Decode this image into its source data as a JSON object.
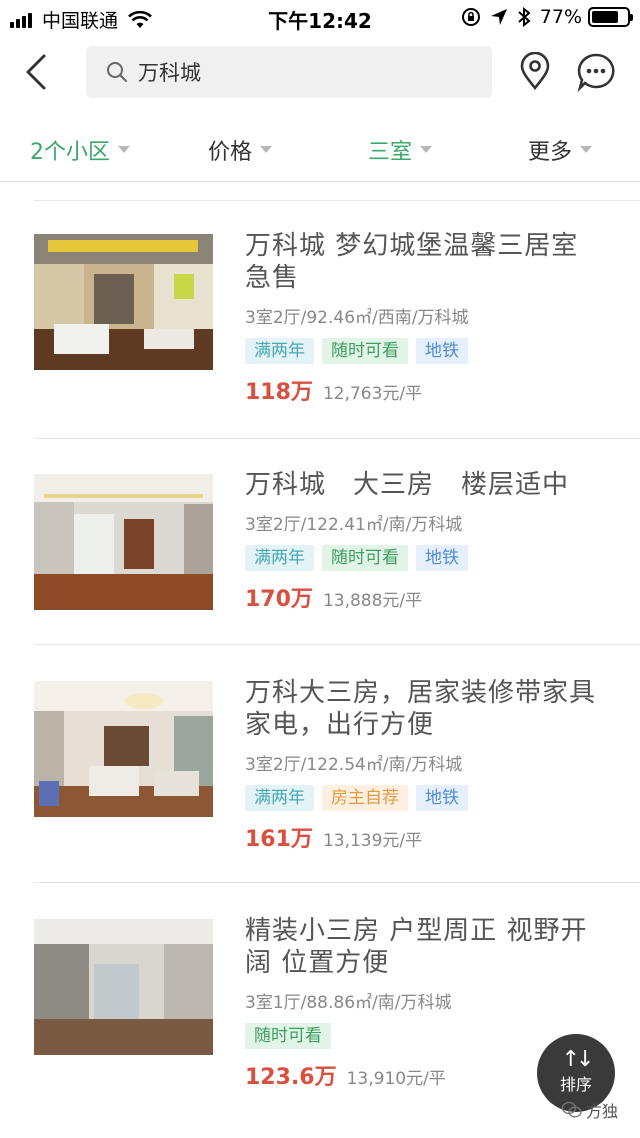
{
  "status_bar": {
    "carrier": "中国联通",
    "time": "下午12:42",
    "battery": "77%",
    "battery_level": 0.77
  },
  "search": {
    "query": "万科城"
  },
  "filters": [
    {
      "label": "2个小区",
      "active": true
    },
    {
      "label": "价格",
      "active": false
    },
    {
      "label": "三室",
      "active": true
    },
    {
      "label": "更多",
      "active": false
    }
  ],
  "listings": [
    {
      "title": "万科城 梦幻城堡温馨三居室急售",
      "meta": "3室2厅/92.46㎡/西南/万科城",
      "tags": [
        {
          "text": "满两年",
          "color": "teal"
        },
        {
          "text": "随时可看",
          "color": "green"
        },
        {
          "text": "地铁",
          "color": "blue"
        }
      ],
      "price": "118万",
      "unit_price": "12,763元/平"
    },
    {
      "title": "万科城　大三房　楼层适中",
      "meta": "3室2厅/122.41㎡/南/万科城",
      "tags": [
        {
          "text": "满两年",
          "color": "teal"
        },
        {
          "text": "随时可看",
          "color": "green"
        },
        {
          "text": "地铁",
          "color": "blue"
        }
      ],
      "price": "170万",
      "unit_price": "13,888元/平"
    },
    {
      "title": "万科大三房，居家装修带家具家电，出行方便",
      "meta": "3室2厅/122.54㎡/南/万科城",
      "tags": [
        {
          "text": "满两年",
          "color": "teal"
        },
        {
          "text": "房主自荐",
          "color": "orange"
        },
        {
          "text": "地铁",
          "color": "blue"
        }
      ],
      "price": "161万",
      "unit_price": "13,139元/平"
    },
    {
      "title": "精装小三房 户型周正 视野开阔 位置方便",
      "meta": "3室1厅/88.86㎡/南/万科城",
      "tags": [
        {
          "text": "随时可看",
          "color": "green"
        }
      ],
      "price": "123.6万",
      "unit_price": "13,910元/平"
    }
  ],
  "sort_button": {
    "label": "排序",
    "arrows": "↑↓"
  },
  "watermark": {
    "text": "方独"
  }
}
